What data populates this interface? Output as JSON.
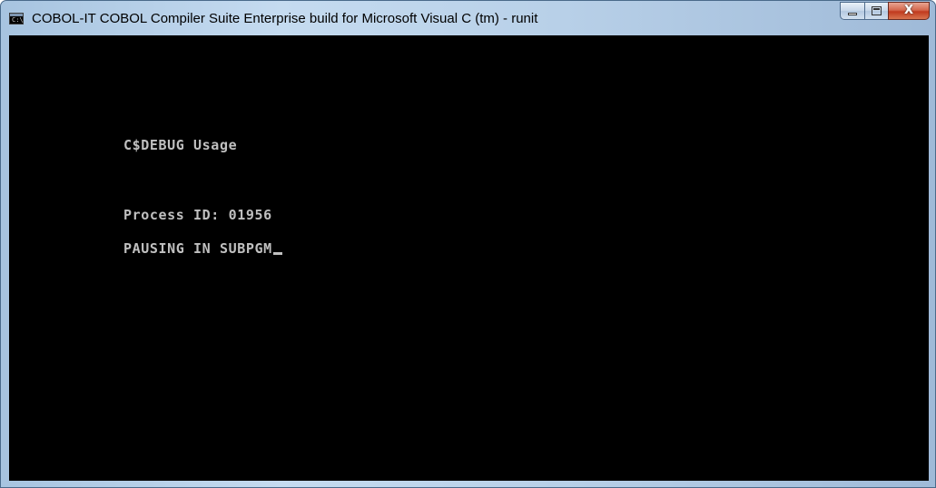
{
  "window": {
    "title": "COBOL-IT COBOL Compiler Suite Enterprise build for Microsoft Visual C (tm) - runit",
    "icon": "console-app-icon",
    "icon_glyph": "C:\\",
    "buttons": {
      "minimize": "minimize-icon",
      "maximize": "maximize-icon",
      "close_label": "X"
    }
  },
  "console": {
    "lines": [
      "C$DEBUG Usage",
      "Process ID: 01956",
      "PAUSING IN SUBPGM"
    ],
    "background": "#000000",
    "text_color": "#c0c0c0"
  }
}
